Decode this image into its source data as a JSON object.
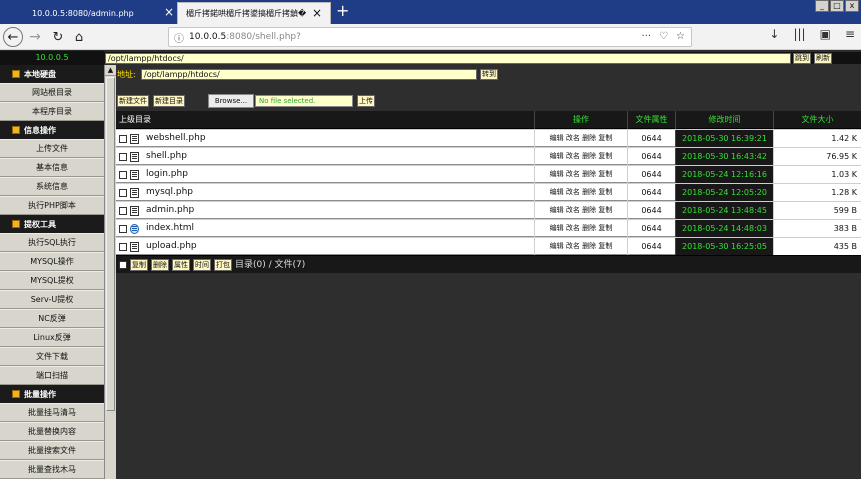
{
  "browser": {
    "tabs": [
      {
        "title": "10.0.0.5:8080/admin.php",
        "active": false
      },
      {
        "title": "楣斤拷鍩哄楣斤拷鍙搞楣斤拷鍞�",
        "active": true
      }
    ],
    "url_host": "10.0.0.5",
    "url_path": ":8080/shell.php?",
    "win_minimize": "_",
    "win_maximize": "□",
    "win_close": "x"
  },
  "sidebar": {
    "ip": "10.0.0.5",
    "sections": [
      {
        "title": "本地硬盘",
        "items": [
          "网站根目录",
          "本程序目录"
        ]
      },
      {
        "title": "信息操作",
        "items": [
          "上传文件",
          "基本信息",
          "系统信息",
          "执行PHP脚本"
        ]
      },
      {
        "title": "提权工具",
        "items": [
          "执行SQL执行",
          "MYSQL操作",
          "MYSQL提权",
          "Serv-U提权",
          "NC反弹",
          "Linux反弹",
          "文件下载",
          "端口扫描"
        ]
      },
      {
        "title": "批量操作",
        "items": [
          "批量挂马清马",
          "批量替换内容",
          "批量搜索文件",
          "批量查找木马"
        ]
      }
    ]
  },
  "pathbar": {
    "value": "/opt/lampp/htdocs/",
    "go_label": "跳到",
    "refresh_label": "刷新"
  },
  "address": {
    "label": "地址:",
    "value": "/opt/lampp/htdocs/",
    "go_label": "转到"
  },
  "tools": {
    "new_file": "新建文件",
    "new_dir": "新建目录",
    "browse": "Browse...",
    "file_status": "No file selected.",
    "upload": "上传"
  },
  "table": {
    "headers": [
      "上级目录",
      "操作",
      "文件属性",
      "修改时间",
      "文件大小"
    ],
    "ops": "编辑 改名 删除 复制",
    "rows": [
      {
        "name": "webshell.php",
        "icon": "text-file-icon",
        "perm": "0644",
        "time": "2018-05-30 16:39:21",
        "size": "1.42 K"
      },
      {
        "name": "shell.php",
        "icon": "text-file-icon",
        "perm": "0644",
        "time": "2018-05-30 16:43:42",
        "size": "76.95 K"
      },
      {
        "name": "login.php",
        "icon": "text-file-icon",
        "perm": "0644",
        "time": "2018-05-24 12:16:16",
        "size": "1.03 K"
      },
      {
        "name": "mysql.php",
        "icon": "text-file-icon",
        "perm": "0644",
        "time": "2018-05-24 12:05:20",
        "size": "1.28 K"
      },
      {
        "name": "admin.php",
        "icon": "text-file-icon",
        "perm": "0644",
        "time": "2018-05-24 13:48:45",
        "size": "599 B"
      },
      {
        "name": "index.html",
        "icon": "html-file-icon",
        "perm": "0644",
        "time": "2018-05-24 14:48:03",
        "size": "383 B"
      },
      {
        "name": "upload.php",
        "icon": "text-file-icon",
        "perm": "0644",
        "time": "2018-05-30 16:25:05",
        "size": "435 B"
      }
    ]
  },
  "footer": {
    "buttons": [
      "复制",
      "删除",
      "属性",
      "时间",
      "打包"
    ],
    "summary": "目录(0) / 文件(7)"
  }
}
